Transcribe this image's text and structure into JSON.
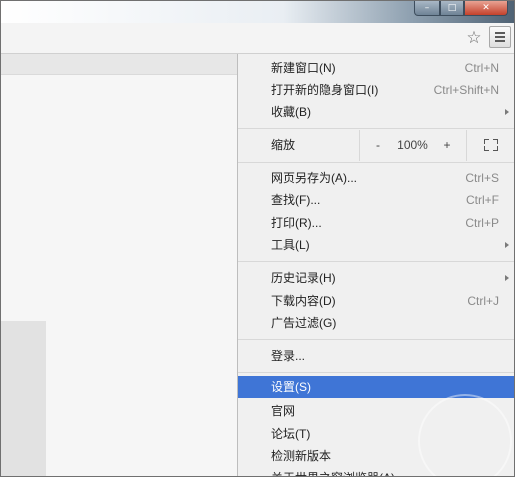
{
  "window": {
    "minimize_glyph": "–",
    "maximize_glyph": "□",
    "close_glyph": "✕"
  },
  "toolbar": {
    "star_glyph": "☆",
    "icons": [
      "bookmark-star-icon",
      "menu-icon"
    ]
  },
  "menu": {
    "group1": [
      {
        "label": "新建窗口(N)",
        "shortcut": "Ctrl+N"
      },
      {
        "label": "打开新的隐身窗口(I)",
        "shortcut": "Ctrl+Shift+N"
      },
      {
        "label": "收藏(B)",
        "shortcut": ""
      }
    ],
    "zoom": {
      "label": "缩放",
      "minus": "-",
      "value": "100%",
      "plus": "+"
    },
    "group2": [
      {
        "label": "网页另存为(A)...",
        "shortcut": "Ctrl+S"
      },
      {
        "label": "查找(F)...",
        "shortcut": "Ctrl+F"
      },
      {
        "label": "打印(R)...",
        "shortcut": "Ctrl+P"
      },
      {
        "label": "工具(L)",
        "shortcut": ""
      }
    ],
    "group3": [
      {
        "label": "历史记录(H)",
        "shortcut": ""
      },
      {
        "label": "下载内容(D)",
        "shortcut": "Ctrl+J"
      },
      {
        "label": "广告过滤(G)",
        "shortcut": ""
      }
    ],
    "group4": [
      {
        "label": "登录...",
        "shortcut": ""
      }
    ],
    "group5": [
      {
        "label": "设置(S)",
        "shortcut": ""
      },
      {
        "label": "官网",
        "shortcut": ""
      },
      {
        "label": "论坛(T)",
        "shortcut": ""
      },
      {
        "label": "检测新版本",
        "shortcut": ""
      },
      {
        "label": "关于世界之窗浏览器(A)",
        "shortcut": ""
      }
    ]
  },
  "colors": {
    "highlight": "#3f75d6",
    "menu_bg": "#f0f0f0"
  }
}
